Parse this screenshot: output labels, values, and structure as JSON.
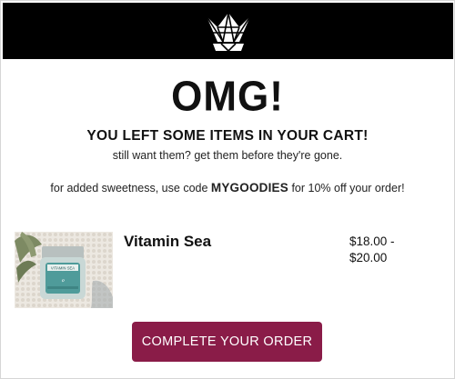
{
  "header": {
    "logo_icon": "crown-icon",
    "background": "#000000"
  },
  "hero": {
    "headline": "OMG!",
    "subhead": "YOU LEFT SOME ITEMS IN YOUR CART!",
    "tagline": "still want them? get them before they're gone."
  },
  "promo": {
    "prefix": "for added sweetness, use code ",
    "code": "MYGOODIES",
    "suffix": " for 10% off your order!"
  },
  "product": {
    "name": "Vitamin Sea",
    "price_line1": "$18.00 -",
    "price_line2": "$20.00",
    "image_label": "VITAMIN SEA"
  },
  "cta": {
    "label": "COMPLETE YOUR ORDER",
    "color": "#8a1c48"
  }
}
